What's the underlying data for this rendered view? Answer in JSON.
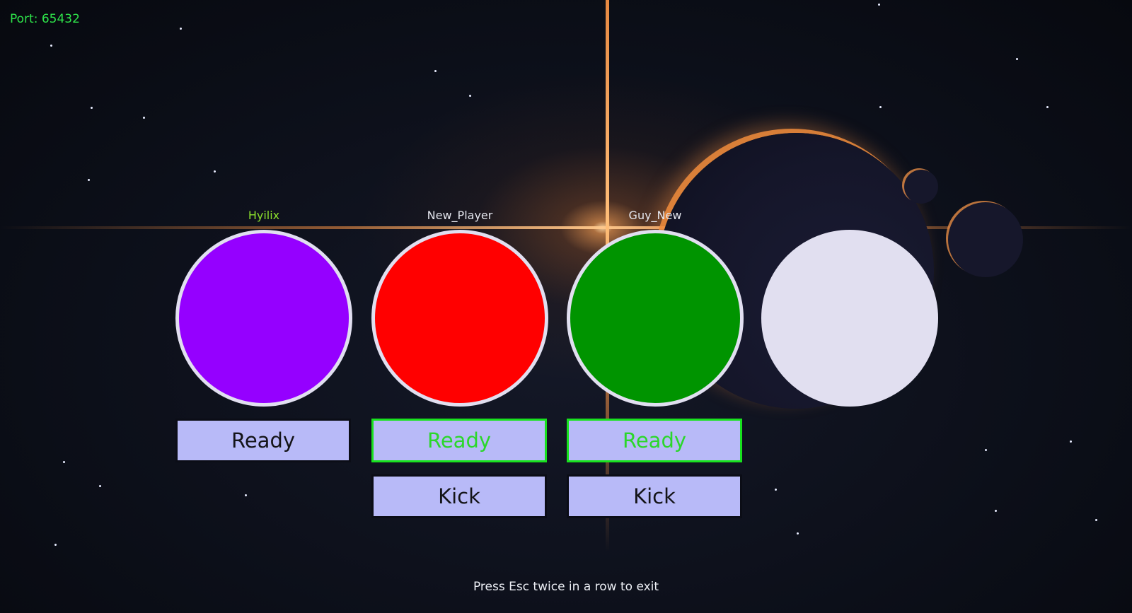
{
  "server": {
    "port_label": "Port: 65432"
  },
  "players": [
    {
      "name": "Hyilix",
      "color": "#9500ff",
      "ready_label": "Ready",
      "ready_active": false,
      "kick_label": null
    },
    {
      "name": "New_Player",
      "color": "#ff0000",
      "ready_label": "Ready",
      "ready_active": true,
      "kick_label": "Kick"
    },
    {
      "name": "Guy_New",
      "color": "#009400",
      "ready_label": "Ready",
      "ready_active": true,
      "kick_label": "Kick"
    },
    {
      "name": "",
      "color": "#e1dff0",
      "ready_label": null,
      "ready_active": false,
      "kick_label": null
    }
  ],
  "footer": {
    "hint": "Press Esc twice in a row to exit"
  }
}
